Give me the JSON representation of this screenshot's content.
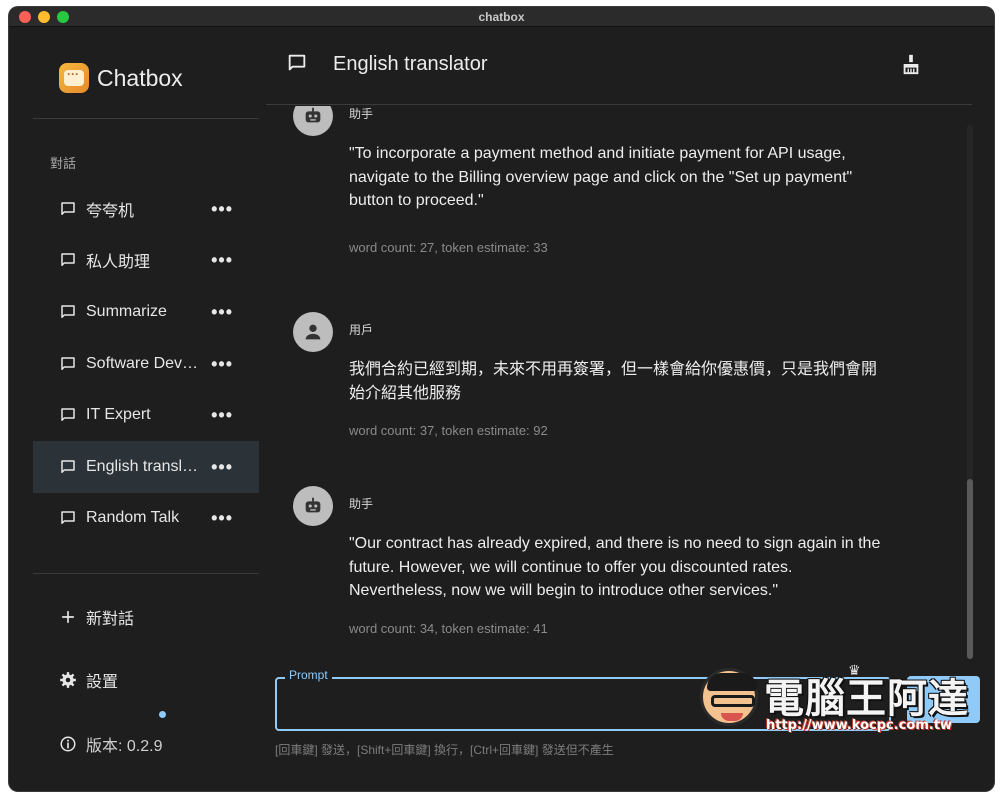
{
  "window": {
    "title": "chatbox"
  },
  "sidebar": {
    "app_name": "Chatbox",
    "section_label": "對話",
    "conversations": [
      {
        "label": "夸夸机",
        "active": false
      },
      {
        "label": "私人助理",
        "active": false
      },
      {
        "label": "Summarize",
        "active": false
      },
      {
        "label": "Software Dev…",
        "active": false
      },
      {
        "label": "IT Expert",
        "active": false
      },
      {
        "label": "English transl…",
        "active": true
      },
      {
        "label": "Random Talk",
        "active": false
      }
    ],
    "more_glyph": "•••",
    "new_chat_label": "新對話",
    "settings_label": "設置",
    "version_label": "版本: 0.2.9"
  },
  "header": {
    "title": "English translator",
    "clean_icon": "broom-icon"
  },
  "messages": [
    {
      "role": "助手",
      "avatar": "robot-icon",
      "text": "\"To incorporate a payment method and initiate payment for API usage, navigate to the Billing overview page and click on the \"Set up payment\" button to proceed.\"",
      "meta": "word count: 27, token estimate: 33"
    },
    {
      "role": "用戶",
      "avatar": "person-icon",
      "text": "我們合約已經到期，未來不用再簽署，但一樣會給你優惠價，只是我們會開始介紹其他服務",
      "meta": "word count: 37, token estimate: 92"
    },
    {
      "role": "助手",
      "avatar": "robot-icon",
      "text": "\"Our contract has already expired, and there is no need to sign again in the future. However, we will continue to offer you discounted rates. Nevertheless, now we will begin to introduce other services.\"",
      "meta": "word count: 34, token estimate: 41"
    }
  ],
  "composer": {
    "legend": "Prompt",
    "value": "",
    "send_label": "",
    "hint": "[回車鍵] 發送，[Shift+回車鍵] 換行，[Ctrl+回車鍵] 發送但不產生"
  },
  "watermark": {
    "title": "電腦王阿達",
    "url": "http://www.kocpc.com.tw"
  },
  "colors": {
    "accent": "#90caf9",
    "background": "#1e1e1e",
    "active_item": "#2c3338"
  }
}
